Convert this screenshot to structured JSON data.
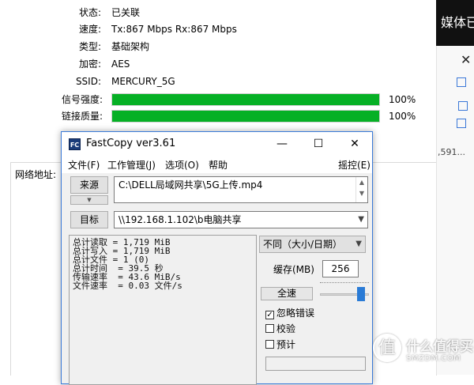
{
  "status_window": {
    "rows": [
      {
        "label": "状态:",
        "value": "已关联"
      },
      {
        "label": "速度:",
        "value": "Tx:867 Mbps Rx:867 Mbps"
      },
      {
        "label": "类型:",
        "value": "基础架构"
      },
      {
        "label": "加密:",
        "value": "AES"
      },
      {
        "label": "SSID:",
        "value": "MERCURY_5G"
      }
    ],
    "bars": [
      {
        "label": "信号强度:",
        "percent": 100,
        "percent_text": "100%"
      },
      {
        "label": "链接质量:",
        "percent": 100,
        "percent_text": "100%"
      }
    ],
    "network_address_label": "网络地址:"
  },
  "right_panel": {
    "header_text": "媒体已",
    "number_fragment": ",591..."
  },
  "watermark": {
    "logo_char": "值",
    "text_cn": "什么值得买",
    "text_en": "SMZDM.COM"
  },
  "fastcopy": {
    "app_icon_text": "FC",
    "title": "FastCopy ver3.61",
    "titlebar_buttons": {
      "minimize": "—",
      "maximize": "☐",
      "close": "✕"
    },
    "menu": [
      "文件(F)",
      "工作管理(J)",
      "选项(O)",
      "帮助"
    ],
    "menu_right": "摇控(E)",
    "source_button": "来源",
    "source_path": "C:\\DELL局域网共享\\5G上传.mp4",
    "target_button": "目标",
    "target_path": "\\\\192.168.1.102\\b电脑共享",
    "stats": [
      "总计读取 = 1,719 MiB",
      "总计写入 = 1,719 MiB",
      "总计文件 = 1 (0)",
      "总计时间  = 39.5 秒",
      "传输速率  = 43.6 MiB/s",
      "文件速率  = 0.03 文件/s"
    ],
    "mode_select": "不同（大小/日期）",
    "buffer_label": "缓存(MB)",
    "buffer_value": "256",
    "speed_button": "全速",
    "speed_level": 0.9,
    "options": [
      {
        "label": "忽略错误",
        "checked": true
      },
      {
        "label": "校验",
        "checked": false
      },
      {
        "label": "预计",
        "checked": false
      }
    ]
  }
}
